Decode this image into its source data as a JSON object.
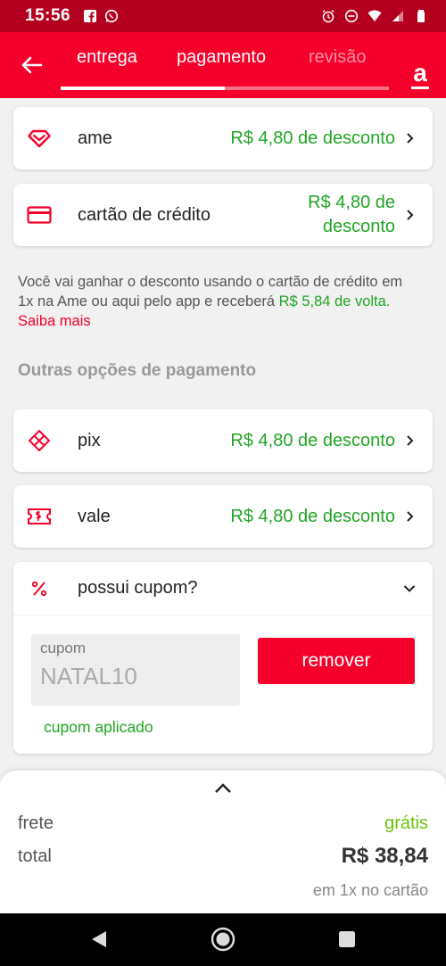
{
  "status_bar": {
    "time": "15:56"
  },
  "header": {
    "tabs": [
      {
        "label": "entrega",
        "active": false
      },
      {
        "label": "pagamento",
        "active": true
      },
      {
        "label": "revisão",
        "active": false
      }
    ],
    "progress": 0.5,
    "brand_letter": "a"
  },
  "payment_options": [
    {
      "icon": "ame-heart-icon",
      "label": "ame",
      "discount": "R$ 4,80 de desconto"
    },
    {
      "icon": "credit-card-icon",
      "label": "cartão de crédito",
      "discount_line1": "R$ 4,80 de",
      "discount_line2": "desconto"
    }
  ],
  "info": {
    "text": "Você vai ganhar o desconto usando o cartão de crédito em 1x na Ame ou aqui pelo app e receberá ",
    "cashback": "R$ 5,84 de volta.",
    "link": "Saiba mais"
  },
  "other_options_title": "Outras opções de pagamento",
  "other_options": [
    {
      "icon": "pix-icon",
      "label": "pix",
      "discount": "R$ 4,80 de desconto"
    },
    {
      "icon": "voucher-icon",
      "label": "vale",
      "discount": "R$ 4,80 de desconto"
    }
  ],
  "coupon": {
    "question": "possui cupom?",
    "field_label": "cupom",
    "field_value": "NATAL10",
    "remove_label": "remover",
    "status": "cupom aplicado"
  },
  "summary": {
    "frete_label": "frete",
    "frete_value": "grátis",
    "total_label": "total",
    "total_value": "R$ 38,84",
    "total_sub": "em 1x no cartão"
  },
  "colors": {
    "brand": "#f4002a",
    "status_bar": "#b4001f",
    "discount_green": "#21a524",
    "free_green": "#6ac40c"
  }
}
